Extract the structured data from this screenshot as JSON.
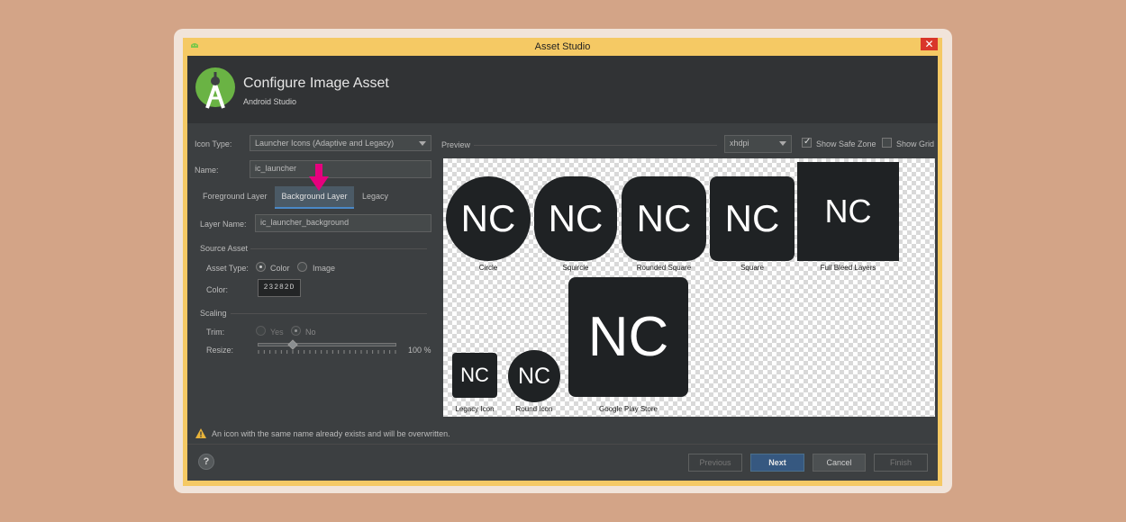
{
  "window": {
    "title": "Asset Studio",
    "close_label": "✕"
  },
  "header": {
    "title": "Configure Image Asset",
    "subtitle": "Android Studio"
  },
  "form": {
    "icon_type_label": "Icon Type:",
    "icon_type_value": "Launcher Icons (Adaptive and Legacy)",
    "name_label": "Name:",
    "name_value": "ic_launcher",
    "tabs": [
      "Foreground Layer",
      "Background Layer",
      "Legacy"
    ],
    "selected_tab": "Background Layer",
    "layer_name_label": "Layer Name:",
    "layer_name_value": "ic_launcher_background",
    "source_asset_label": "Source Asset",
    "asset_type_label": "Asset Type:",
    "asset_type_options": [
      "Color",
      "Image"
    ],
    "asset_type_selected": "Color",
    "color_label": "Color:",
    "color_value": "23282D",
    "scaling_label": "Scaling",
    "trim_label": "Trim:",
    "trim_options": [
      "Yes",
      "No"
    ],
    "trim_selected": "No",
    "resize_label": "Resize:",
    "resize_value": "100 %",
    "resize_level": 0.25
  },
  "preview": {
    "label": "Preview",
    "density": "xhdpi",
    "show_safe_zone_label": "Show Safe Zone",
    "show_safe_zone_checked": true,
    "show_grid_label": "Show Grid",
    "show_grid_checked": false,
    "icon_text": "NC",
    "icon_color": "#1f2224",
    "captions": [
      "Circle",
      "Squircle",
      "Rounded Square",
      "Square",
      "Full Bleed Layers",
      "Legacy Icon",
      "Round Icon",
      "Google Play Store"
    ]
  },
  "warning": {
    "icon": "warning-icon",
    "text": "An icon with the same name already exists and will be overwritten."
  },
  "footer": {
    "help_label": "?",
    "previous_label": "Previous",
    "next_label": "Next",
    "cancel_label": "Cancel",
    "finish_label": "Finish"
  },
  "colors": {
    "accent": "#365880",
    "highlight_arrow": "#e6007e",
    "background": "#d3a487"
  }
}
